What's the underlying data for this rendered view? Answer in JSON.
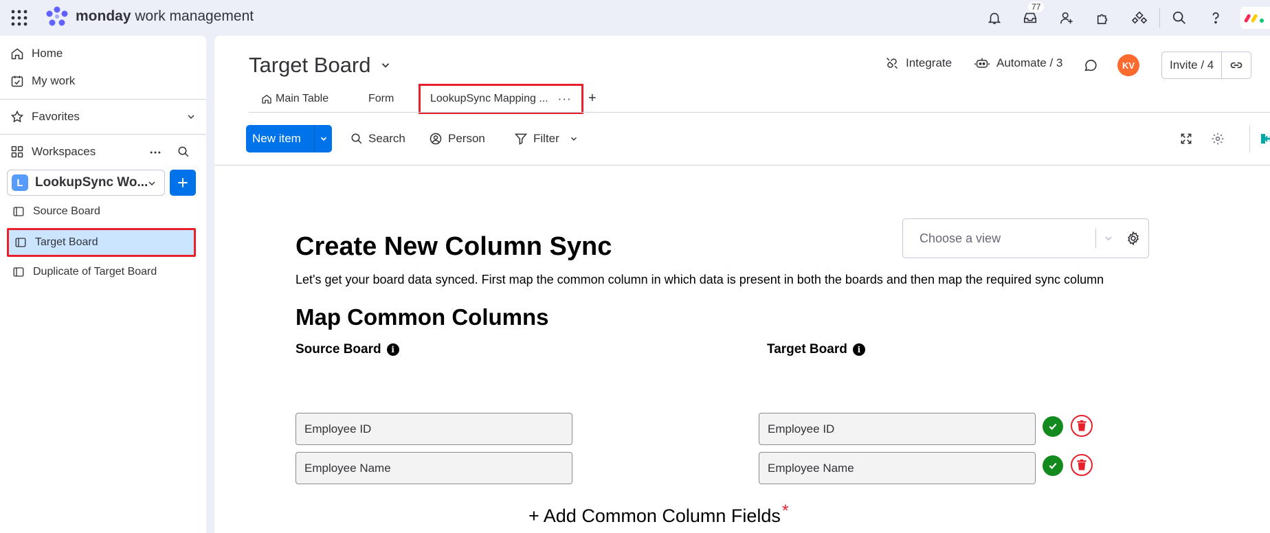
{
  "topbar": {
    "brand_bold": "monday",
    "brand_rest": " work management",
    "inbox_badge": "77",
    "icons": [
      "apps-grid-icon",
      "bell-icon",
      "inbox-icon",
      "invite-member-icon",
      "apps-puzzle-icon",
      "shapes-icon",
      "search-icon",
      "help-icon"
    ]
  },
  "sidebar": {
    "home": "Home",
    "my_work": "My work",
    "favorites": "Favorites",
    "workspaces": "Workspaces",
    "workspace_letter": "L",
    "workspace_name": "LookupSync Wo...",
    "boards": [
      "Source Board",
      "Target Board",
      "Duplicate of Target Board"
    ],
    "active_board_index": 1
  },
  "header": {
    "board_title": "Target Board",
    "integrate": "Integrate",
    "automate": "Automate / 3",
    "avatar_initials": "KV",
    "invite": "Invite / 4"
  },
  "tabs": {
    "main_table": "Main Table",
    "form": "Form",
    "lookupsync": "LookupSync Mapping ...",
    "dots": "···",
    "add": "+"
  },
  "toolbar": {
    "new_item": "New item",
    "search": "Search",
    "person": "Person",
    "filter": "Filter"
  },
  "content": {
    "view_placeholder": "Choose a view",
    "title": "Create New Column Sync",
    "description": "Let's get your board data synced. First map the common column in which data is present in both the boards and then map the required sync column",
    "section_title": "Map Common Columns",
    "source_label": "Source Board",
    "target_label": "Target Board",
    "info_glyph": "i",
    "rows": [
      {
        "source": "Employee ID",
        "target": "Employee ID"
      },
      {
        "source": "Employee Name",
        "target": "Employee Name"
      }
    ],
    "add_fields": "+ Add Common Column Fields",
    "required_mark": "*"
  },
  "colors": {
    "accent": "#0073ea",
    "highlight": "#e8202b",
    "success": "#138a1d",
    "avatar": "#fb6b2f"
  }
}
